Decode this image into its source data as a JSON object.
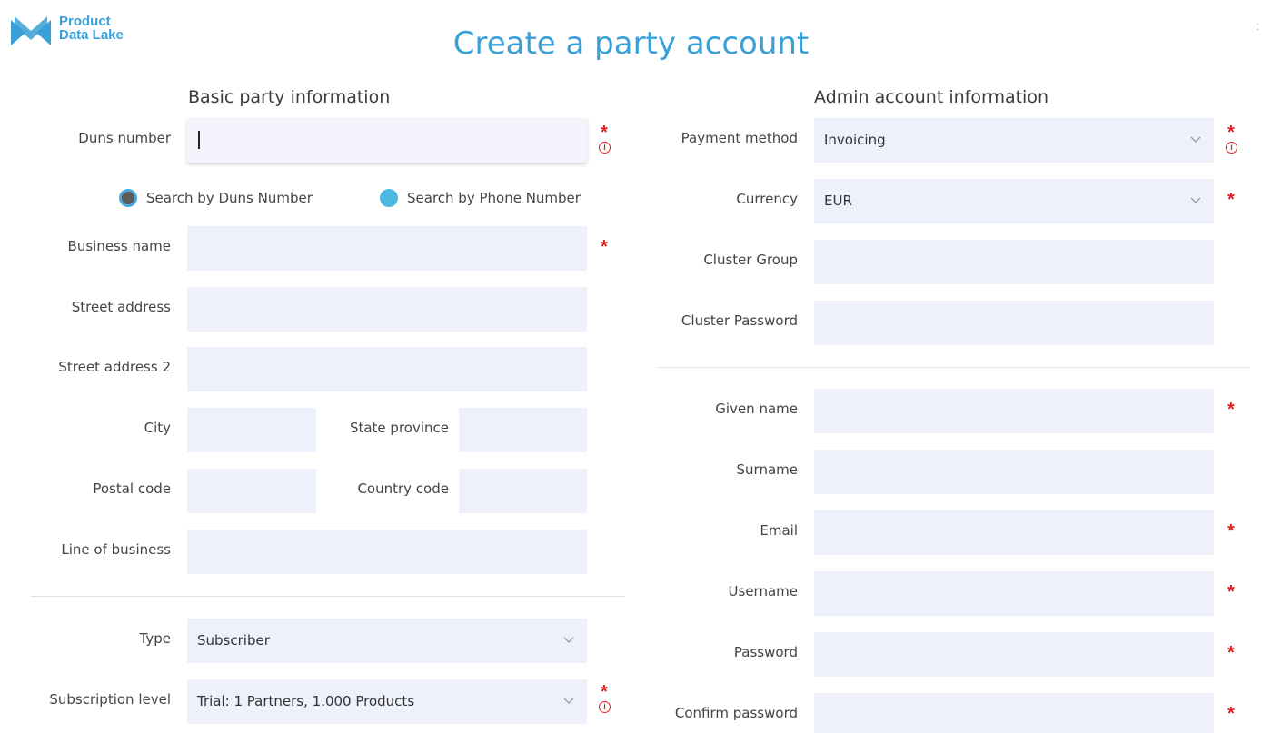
{
  "app": {
    "logo_line1": "Product",
    "logo_line2": "Data Lake",
    "title": "Create a party account"
  },
  "colors": {
    "accent": "#3aa0d8",
    "field_bg": "#eef1fb",
    "required": "#e02020"
  },
  "basic": {
    "section_title": "Basic party information",
    "duns_label": "Duns number",
    "duns_value": "",
    "search_duns_label": "Search by Duns Number",
    "search_phone_label": "Search by Phone Number",
    "business_name_label": "Business name",
    "street_address_label": "Street address",
    "street_address2_label": "Street address 2",
    "city_label": "City",
    "state_label": "State province",
    "postal_label": "Postal code",
    "country_label": "Country code",
    "line_of_business_label": "Line of business",
    "type_label": "Type",
    "type_value": "Subscriber",
    "subscription_label": "Subscription level",
    "subscription_value": "Trial: 1 Partners, 1.000 Products"
  },
  "admin": {
    "section_title": "Admin account information",
    "payment_label": "Payment method",
    "payment_value": "Invoicing",
    "currency_label": "Currency",
    "currency_value": "EUR",
    "cluster_group_label": "Cluster Group",
    "cluster_password_label": "Cluster Password",
    "given_name_label": "Given name",
    "surname_label": "Surname",
    "email_label": "Email",
    "username_label": "Username",
    "password_label": "Password",
    "confirm_password_label": "Confirm password"
  },
  "markers": {
    "required": "*",
    "info": "i"
  }
}
